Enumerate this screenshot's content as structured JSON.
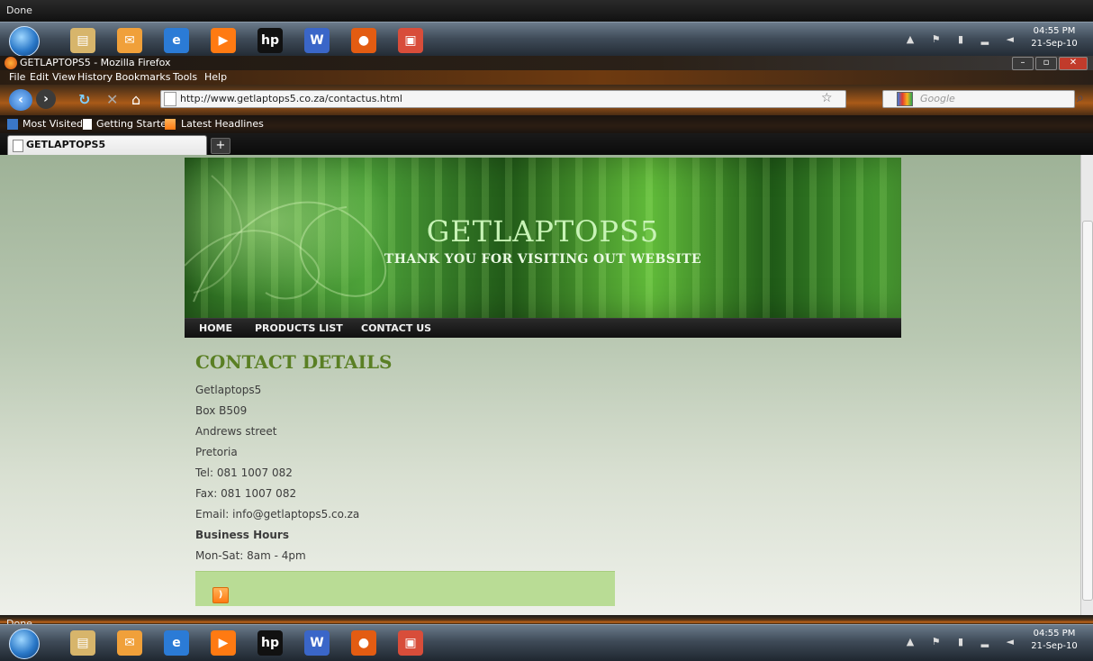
{
  "status_top": "Done",
  "status_bottom": "Done",
  "taskbar": {
    "time": "04:55 PM",
    "date": "21-Sep-10",
    "icons": [
      {
        "name": "folder-icon",
        "glyph": "▤",
        "color": "#d7b56b"
      },
      {
        "name": "mail-icon",
        "glyph": "✉",
        "color": "#f0a03a"
      },
      {
        "name": "internet-explorer-icon",
        "glyph": "e",
        "color": "#2b7bd6"
      },
      {
        "name": "media-player-icon",
        "glyph": "▶",
        "color": "#ff7a12"
      },
      {
        "name": "hp-icon",
        "glyph": "hp",
        "color": "#111111"
      },
      {
        "name": "word-icon",
        "glyph": "W",
        "color": "#3a66c8"
      },
      {
        "name": "firefox-icon",
        "glyph": "●",
        "color": "#e35c12"
      },
      {
        "name": "slides-icon",
        "glyph": "▣",
        "color": "#d84d3a"
      }
    ]
  },
  "browser": {
    "window_title": "GETLAPTOPS5 - Mozilla Firefox",
    "menu": [
      {
        "label": "File"
      },
      {
        "label": "Edit"
      },
      {
        "label": "View"
      },
      {
        "label": "History"
      },
      {
        "label": "Bookmarks"
      },
      {
        "label": "Tools"
      },
      {
        "label": "Help"
      }
    ],
    "url": "http://www.getlaptops5.co.za/contactus.html",
    "search_placeholder": "Google",
    "bookmarks": [
      {
        "label": "Most Visited"
      },
      {
        "label": "Getting Started"
      },
      {
        "label": "Latest Headlines"
      }
    ],
    "tab_title": "GETLAPTOPS5",
    "new_tab_glyph": "+"
  },
  "site": {
    "title": "GETLAPTOPS5",
    "subtitle": "THANK YOU FOR VISITING OUT WEBSITE",
    "nav": [
      {
        "label": "HOME"
      },
      {
        "label": "PRODUCTS LIST"
      },
      {
        "label": "CONTACT US"
      }
    ],
    "heading": "CONTACT DETAILS",
    "lines": {
      "company": "Getlaptops5",
      "box": "Box B509",
      "street": "Andrews street",
      "city": "Pretoria",
      "tel": "Tel: 081 1007 082",
      "fax": "Fax: 081 1007 082",
      "email": "Email: info@getlaptops5.co.za",
      "hours_label": "Business Hours",
      "hours": "Mon-Sat: 8am - 4pm"
    },
    "accent_green": "#5a7f24",
    "footer_green": "#b9dc95"
  }
}
